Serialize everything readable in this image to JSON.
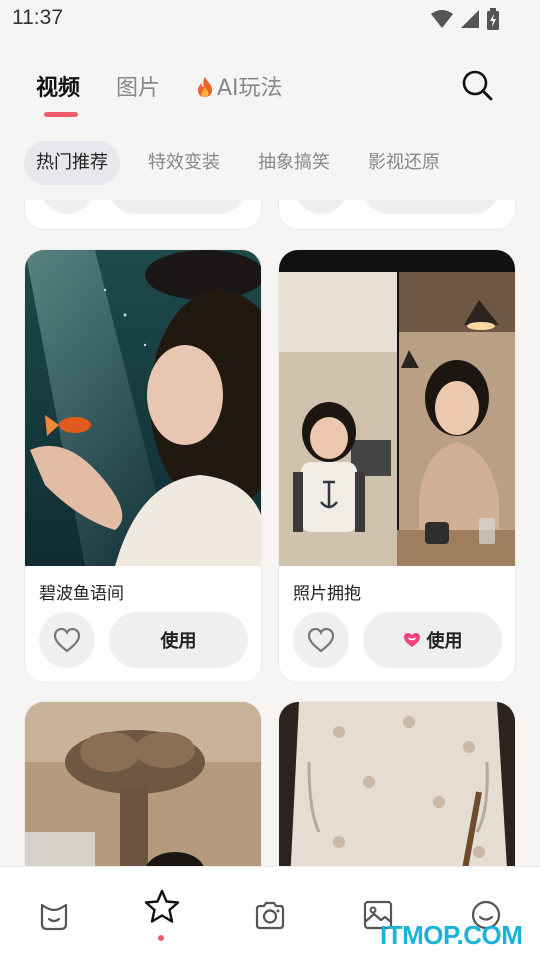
{
  "status_bar": {
    "time": "11:37"
  },
  "tabs": [
    {
      "label": "视频",
      "active": true
    },
    {
      "label": "图片",
      "active": false
    },
    {
      "label": "AI玩法",
      "active": false,
      "icon": "fire-icon"
    }
  ],
  "categories": [
    {
      "label": "热门推荐",
      "active": true
    },
    {
      "label": "特效变装",
      "active": false
    },
    {
      "label": "抽象搞笑",
      "active": false
    },
    {
      "label": "影视还原",
      "active": false
    }
  ],
  "cards": [
    {
      "title": "碧波鱼语间",
      "use_label": "使用",
      "use_icon": ""
    },
    {
      "title": "照片拥抱",
      "use_label": "使用",
      "use_icon": "heart-badge-icon"
    }
  ],
  "bottom_nav": [
    {
      "icon": "smile-bag-icon",
      "active": false
    },
    {
      "icon": "star-icon",
      "active": true
    },
    {
      "icon": "camera-icon",
      "active": false
    },
    {
      "icon": "gallery-icon",
      "active": false
    },
    {
      "icon": "face-icon",
      "active": false
    }
  ],
  "watermark": "ITMOP.COM",
  "colors": {
    "accent": "#f05c6e",
    "background": "#f7f5f4",
    "watermark": "#19b4d8"
  }
}
